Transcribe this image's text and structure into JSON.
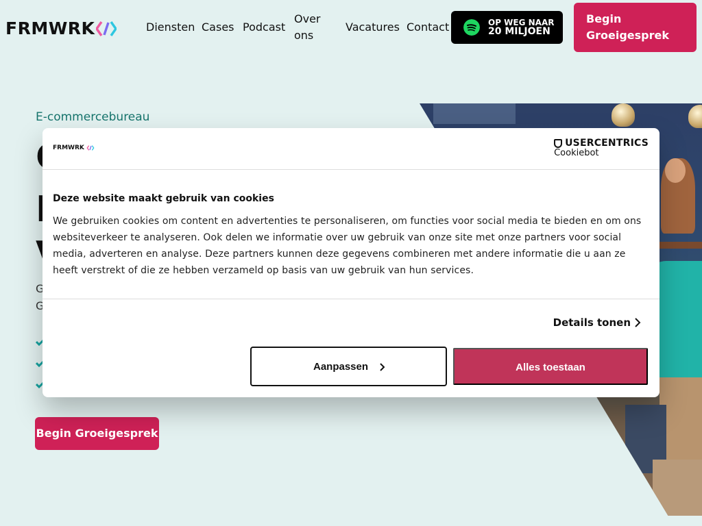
{
  "header": {
    "logo_text": "FRMWRK",
    "nav": [
      "Diensten",
      "Cases",
      "Podcast",
      "Over ons",
      "Vacatures",
      "Contact"
    ],
    "nav_over_line1": "Over",
    "nav_over_line2": "ons",
    "spotify_line1": "OP WEG NAAR",
    "spotify_line2": "20 MILJOEN",
    "cta_line1": "Begin",
    "cta_line2": "Groeigesprek"
  },
  "hero": {
    "eyebrow": "E-commercebureau",
    "title_fragments": [
      "G",
      "E",
      "V"
    ],
    "sub_fragments": [
      "G",
      "G"
    ],
    "cta": "Begin Groeigesprek"
  },
  "cookie": {
    "logo": "FRMWRK",
    "brand_name": "USERCENTRICS",
    "brand_sub": "Cookiebot",
    "title": "Deze website maakt gebruik van cookies",
    "body": "We gebruiken cookies om content en advertenties te personaliseren, om functies voor social media te bieden en om ons websiteverkeer te analyseren. Ook delen we informatie over uw gebruik van onze site met onze partners voor social media, adverteren en analyse. Deze partners kunnen deze gegevens combineren met andere informatie die u aan ze heeft verstrekt of die ze hebben verzameld op basis van uw gebruik van hun services.",
    "details": "Details tonen",
    "adjust": "Aanpassen",
    "allow": "Alles toestaan"
  },
  "colors": {
    "background": "#e3f1f0",
    "brand_pink": "#cf2157",
    "allow_button": "#c03459",
    "eyebrow_teal": "#16746c",
    "spotify_green": "#1ed760"
  },
  "icons": [
    "frmwrk-logo-mark",
    "spotify-icon",
    "check-icon",
    "usercentrics-shield-icon",
    "chevron-right-icon"
  ]
}
